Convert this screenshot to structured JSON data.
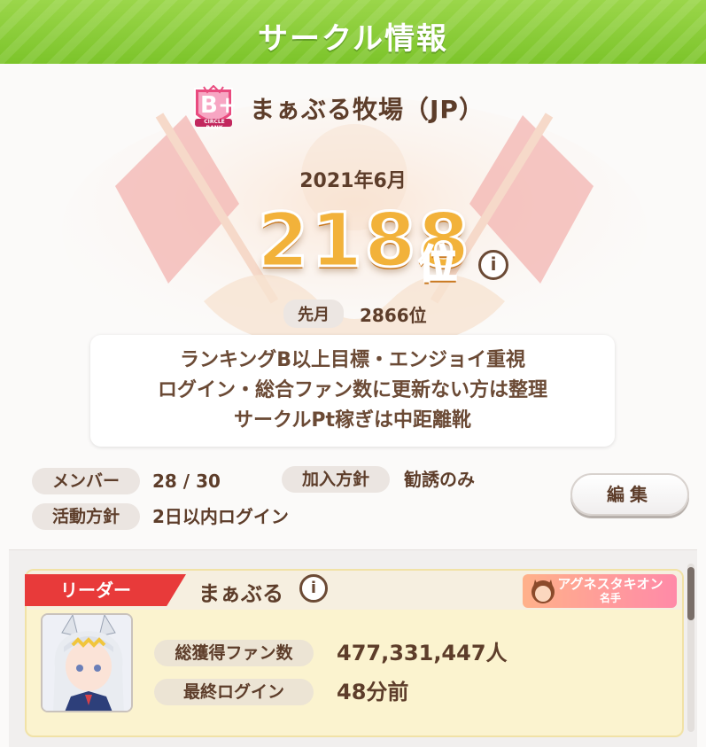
{
  "header": {
    "title": "サークル情報"
  },
  "circle": {
    "rank_badge": "B+",
    "rank_badge_sub": "CIRCLE RANK",
    "name": "まぁぶる牧場（JP）",
    "month": "2021年6月",
    "rank": "2188",
    "rank_suffix": "位",
    "info_icon": "i",
    "prev_label": "先月",
    "prev_value": "2866位",
    "description": [
      "ランキングB以上目標・エンジョイ重視",
      "ログイン・総合ファン数に更新ない方は整理",
      "サークルPt稼ぎは中距離靴"
    ]
  },
  "meta": {
    "members_label": "メンバー",
    "members_value": "28 / 30",
    "join_label": "加入方針",
    "join_value": "勧誘のみ",
    "activity_label": "活動方針",
    "activity_value": "2日以内ログイン",
    "edit_label": "編集"
  },
  "leader": {
    "tag": "リーダー",
    "name": "まぁぶる",
    "info_icon": "i",
    "title_line1": "アグネスタキオン",
    "title_line2": "名手",
    "fans_label": "総獲得ファン数",
    "fans_value": "477,331,447人",
    "login_label": "最終ログイン",
    "login_value": "48分前"
  },
  "colors": {
    "header_green": "#7cc42a",
    "leader_red": "#e83a3a",
    "rank_gold": "#f2b23a",
    "text_brown": "#5d3d2a"
  }
}
